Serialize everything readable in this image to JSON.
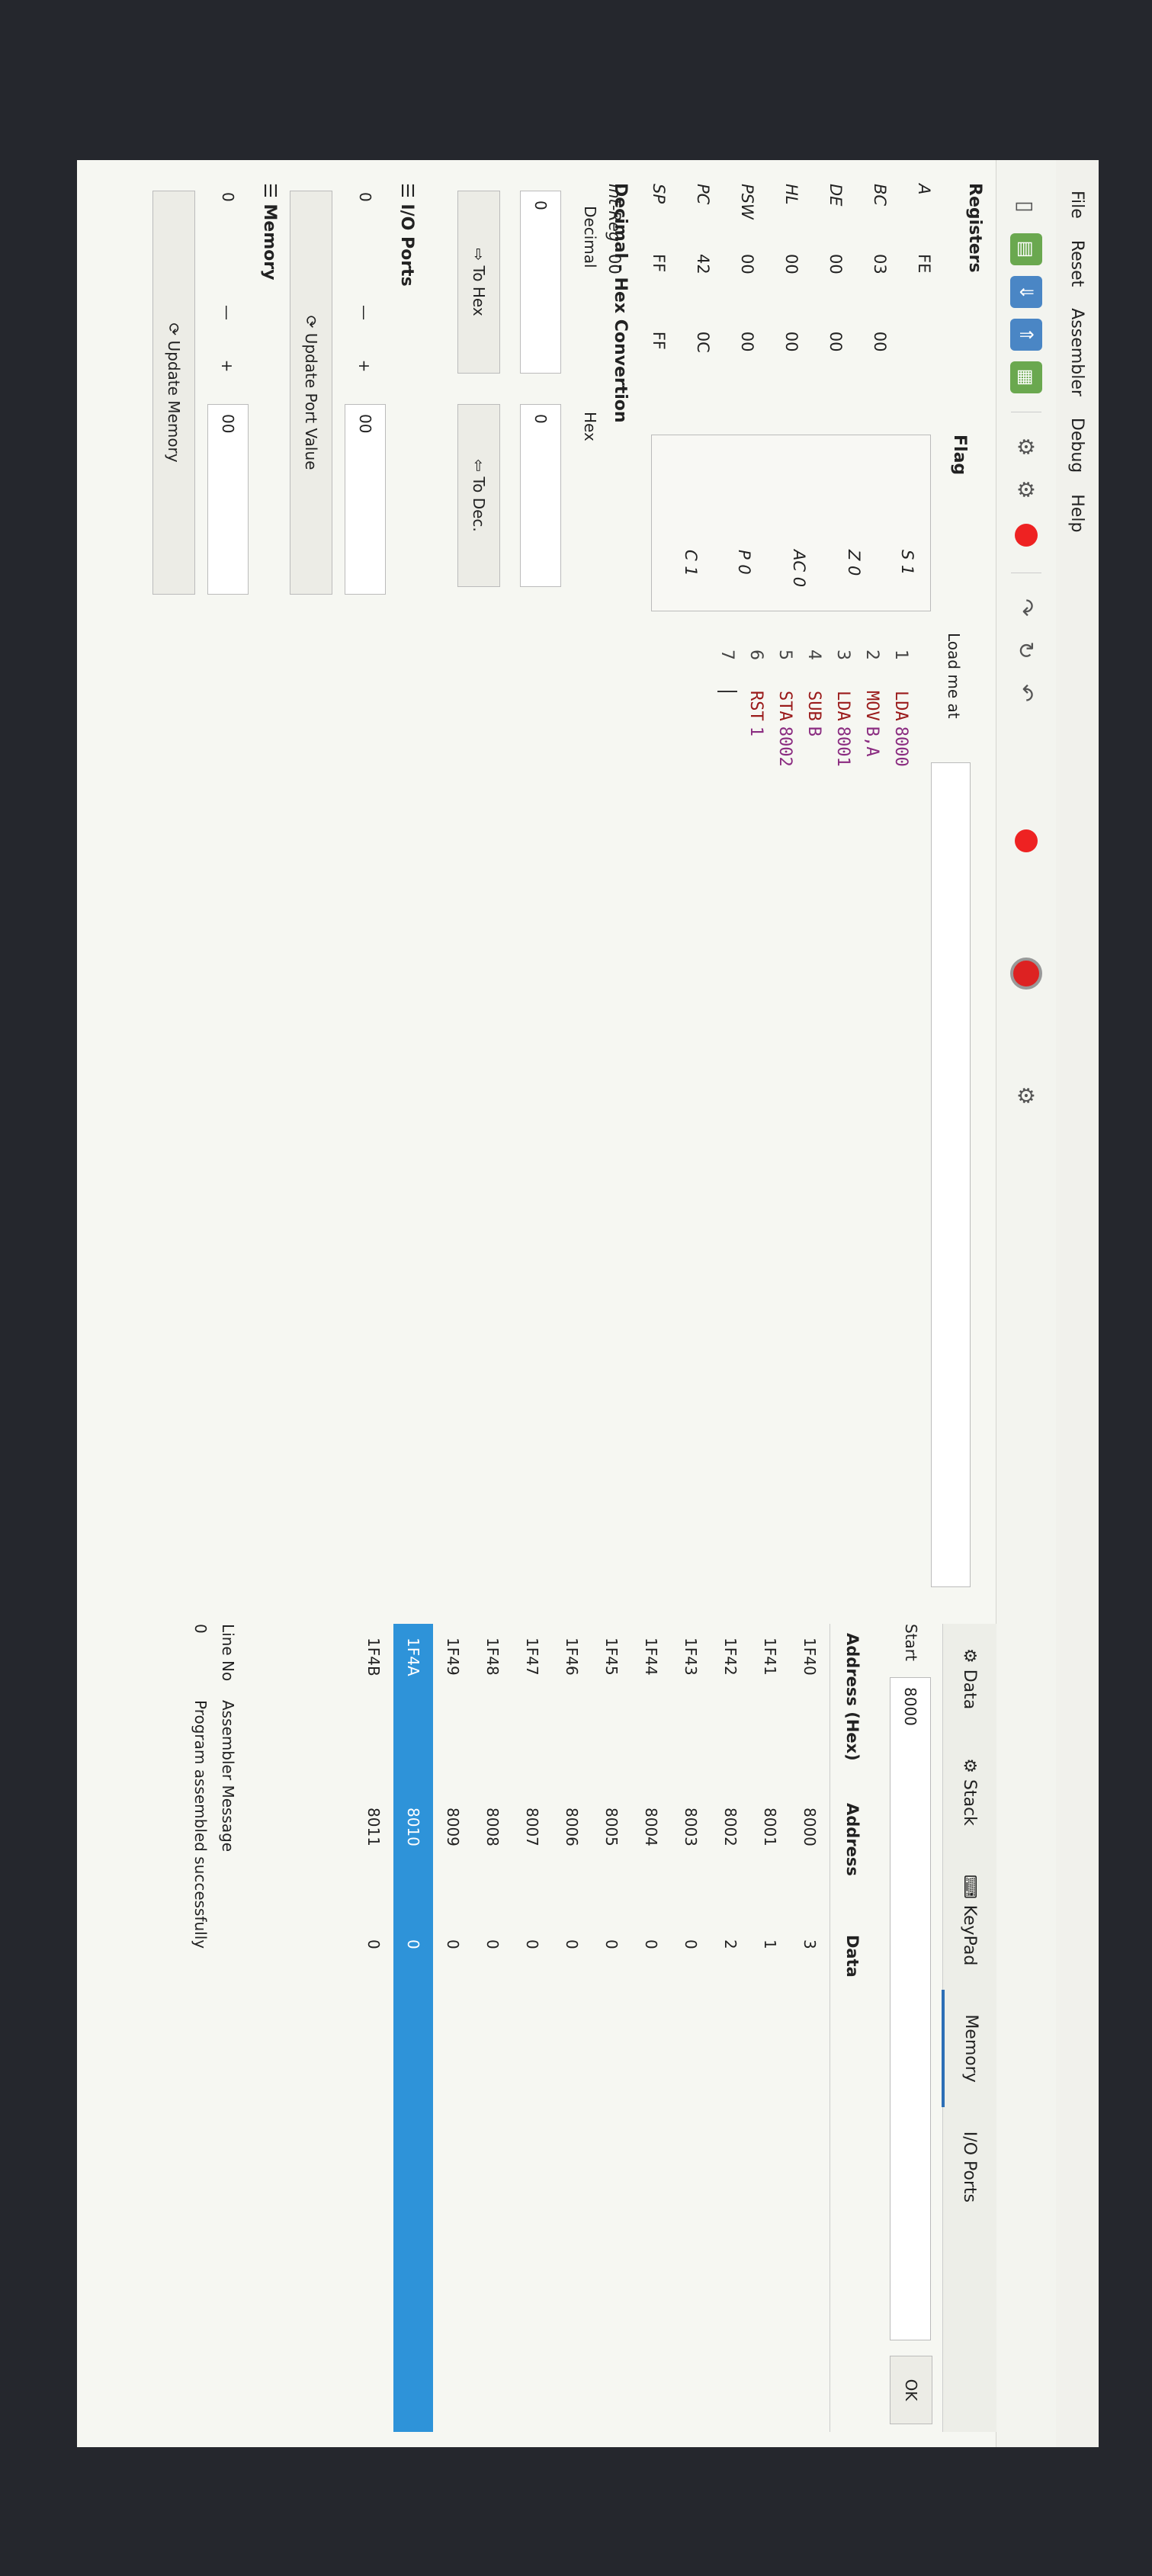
{
  "menu": [
    "File",
    "Reset",
    "Assembler",
    "Debug",
    "Help"
  ],
  "registers": {
    "title": "Registers",
    "rows": [
      {
        "name": "A",
        "v1": "FE",
        "v2": ""
      },
      {
        "name": "BC",
        "v1": "03",
        "v2": "00"
      },
      {
        "name": "DE",
        "v1": "00",
        "v2": "00"
      },
      {
        "name": "HL",
        "v1": "00",
        "v2": "00"
      },
      {
        "name": "PSW",
        "v1": "00",
        "v2": "00"
      },
      {
        "name": "PC",
        "v1": "42",
        "v2": "0C"
      },
      {
        "name": "SP",
        "v1": "FF",
        "v2": "FF"
      },
      {
        "name": "Int-Reg",
        "v1": "00",
        "v2": ""
      }
    ]
  },
  "flags": {
    "title": "Flag",
    "items": [
      "S 1",
      "Z 0",
      "AC 0",
      "P 0",
      "C 1"
    ]
  },
  "conversion": {
    "title": "Decimal - Hex Convertion",
    "decimal_label": "Decimal",
    "hex_label": "Hex",
    "decimal_value": "0",
    "hex_value": "0",
    "to_hex": "To Hex",
    "to_dec": "To Dec."
  },
  "io_ports": {
    "title": "I/O Ports",
    "port": "0",
    "minus": "—",
    "plus": "+",
    "value": "00",
    "update": "Update Port Value"
  },
  "memory_panel": {
    "title": "Memory",
    "addr": "0",
    "minus": "—",
    "plus": "+",
    "value": "00",
    "update": "Update Memory"
  },
  "editor": {
    "load_label": "Load me at",
    "lines": [
      {
        "n": "1",
        "op": "LDA",
        "arg": "8000"
      },
      {
        "n": "2",
        "op": "MOV",
        "arg": "B,A"
      },
      {
        "n": "3",
        "op": "LDA",
        "arg": "8001"
      },
      {
        "n": "4",
        "op": "SUB",
        "arg": "B"
      },
      {
        "n": "5",
        "op": "STA",
        "arg": "8002"
      },
      {
        "n": "6",
        "op": "RST",
        "arg": "1"
      },
      {
        "n": "7",
        "op": "",
        "arg": ""
      }
    ]
  },
  "right": {
    "tabs": [
      "Data",
      "Stack",
      "KeyPad",
      "Memory",
      "I/O Ports"
    ],
    "start_label": "Start",
    "start_value": "8000",
    "ok": "OK",
    "headers": [
      "Address (Hex)",
      "Address",
      "Data"
    ],
    "rows": [
      {
        "hex": "1F40",
        "addr": "8000",
        "data": "3",
        "sel": false
      },
      {
        "hex": "1F41",
        "addr": "8001",
        "data": "1",
        "sel": false
      },
      {
        "hex": "1F42",
        "addr": "8002",
        "data": "2",
        "sel": false
      },
      {
        "hex": "1F43",
        "addr": "8003",
        "data": "0",
        "sel": false
      },
      {
        "hex": "1F44",
        "addr": "8004",
        "data": "0",
        "sel": false
      },
      {
        "hex": "1F45",
        "addr": "8005",
        "data": "0",
        "sel": false
      },
      {
        "hex": "1F46",
        "addr": "8006",
        "data": "0",
        "sel": false
      },
      {
        "hex": "1F47",
        "addr": "8007",
        "data": "0",
        "sel": false
      },
      {
        "hex": "1F48",
        "addr": "8008",
        "data": "0",
        "sel": false
      },
      {
        "hex": "1F49",
        "addr": "8009",
        "data": "0",
        "sel": false
      },
      {
        "hex": "1F4A",
        "addr": "8010",
        "data": "0",
        "sel": true
      },
      {
        "hex": "1F4B",
        "addr": "8011",
        "data": "0",
        "sel": false
      }
    ],
    "msg_headers": [
      "Line No",
      "Assembler Message"
    ],
    "msg_rows": [
      {
        "line": "0",
        "text": "Program assembled successfully"
      }
    ]
  },
  "colors": {
    "accent": "#2e93d9",
    "code_op": "#9a1a1a",
    "code_arg": "#8a2b80"
  }
}
